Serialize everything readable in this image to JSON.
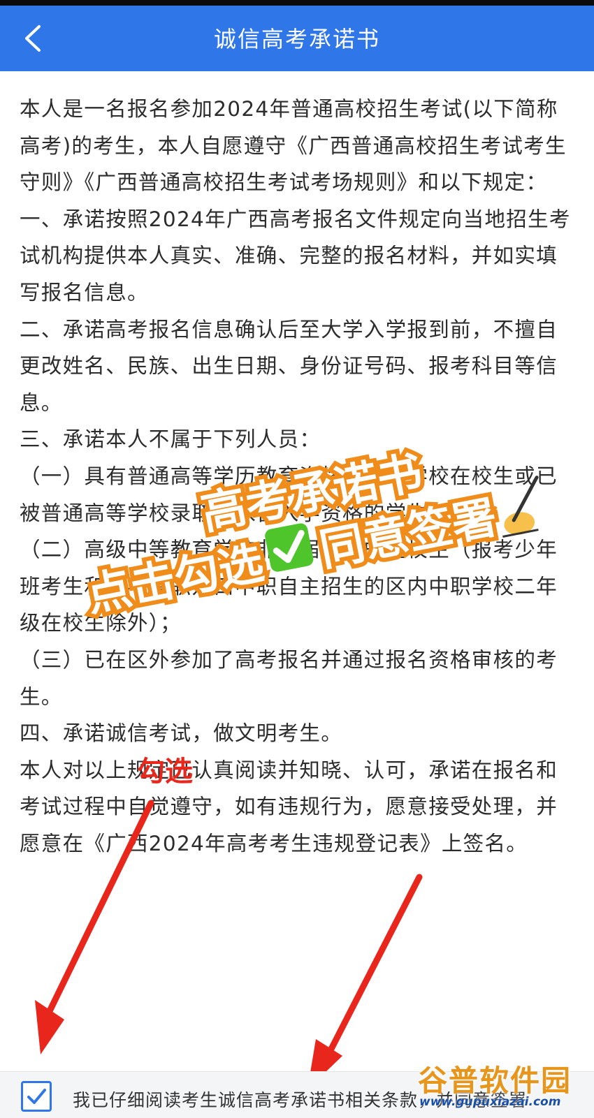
{
  "header": {
    "title": "诚信高考承诺书",
    "back_icon": "chevron-left-icon"
  },
  "content": {
    "paragraphs": [
      "本人是一名报名参加2024年普通高校招生考试(以下简称高考)的考生，本人自愿遵守《广西普通高校招生考试考生守则》《广西普通高校招生考试考场规则》和以下规定：",
      "一、承诺按照2024年广西高考报名文件规定向当地招生考试机构提供本人真实、准确、完整的报名材料，并如实填写报名信息。",
      "二、承诺高考报名信息确认后至大学入学报到前，不擅自更改姓名、民族、出生日期、身份证号码、报考科目等信息。",
      "三、承诺本人不属于下列人员：",
      "（一）具有普通高等学历教育资格的高等学校在校生或已被普通高等学校录取并保留入学资格的学生；",
      "（二）高级中等教育学校非应届毕业的在校生（报考少年班考生和报考高职对口中职自主招生的区内中职学校二年级在校生除外）；",
      "（三）已在区外参加了高考报名并通过报名资格审核的考生。",
      "四、承诺诚信考试，做文明考生。",
      "本人对以上规定已认真阅读并知晓、认可，承诺在报名和考试过程中自觉遵守，如有违规行为，愿意接受处理，并愿意在《广西2024年高考考生违规登记表》上签名。"
    ]
  },
  "overlay": {
    "line1": "高考承诺书",
    "line2_a": "点击勾选",
    "line2_b": "同意签署",
    "check_emoji_icon": "check-mark-button-icon",
    "writing_hand_icon": "writing-hand-icon",
    "annotation": "勾选",
    "arrow_color": "#e8261c",
    "accent_orange": "#f08c1a"
  },
  "footer": {
    "checkbox_checked": true,
    "agree_text": "我已仔细阅读考生诚信高考承诺书相关条款，并同意签署"
  },
  "watermark": {
    "title": "谷普软件园",
    "url": "www.gupuxiazai.com"
  },
  "colors": {
    "header_blue": "#2f76e8",
    "text": "#2c2c2c"
  }
}
